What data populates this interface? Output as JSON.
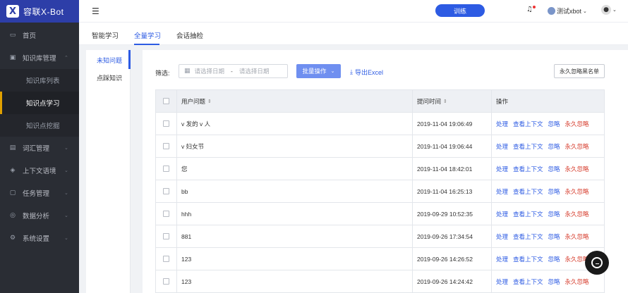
{
  "app": {
    "logo_mark": "X",
    "name": "容联X-Bot"
  },
  "sidebar": {
    "items": [
      {
        "label": "首页",
        "icon": "monitor-icon",
        "glyph": "▭"
      },
      {
        "label": "知识库管理",
        "icon": "book-icon",
        "glyph": "▣",
        "caret": "⌃"
      },
      {
        "label": "词汇管理",
        "icon": "vocabulary-icon",
        "glyph": "▤",
        "caret": "⌄"
      },
      {
        "label": "上下文语境",
        "icon": "graduation-icon",
        "glyph": "◈",
        "caret": "⌄"
      },
      {
        "label": "任务管理",
        "icon": "briefcase-icon",
        "glyph": "▢",
        "caret": "⌄"
      },
      {
        "label": "数据分析",
        "icon": "chart-icon",
        "glyph": "◎",
        "caret": "⌄"
      },
      {
        "label": "系统设置",
        "icon": "gear-icon",
        "glyph": "⚙",
        "caret": "⌄"
      }
    ],
    "subitems": [
      "知识库列表",
      "知识点学习",
      "知识点挖掘"
    ]
  },
  "header": {
    "menu_glyph": "☰",
    "train_label": "训练",
    "bell_glyph": "♫",
    "username": "测试xbot",
    "user_caret": "⌄",
    "avatar_glyph": "●",
    "avatar_caret": "⌄"
  },
  "tabs": [
    "智能学习",
    "全量学习",
    "会话抽检"
  ],
  "subnav": [
    "未知问题",
    "点踩知识"
  ],
  "toolbar": {
    "filter_label": "筛选:",
    "calendar_glyph": "▦",
    "start_placeholder": "请选择日期",
    "range_dash": "-",
    "end_placeholder": "请选择日期",
    "batch_label": "批量操作",
    "batch_caret": "⌄",
    "export_glyph": "⤓",
    "export_label": "导出Excel",
    "blacklist_label": "永久忽略黑名单"
  },
  "table": {
    "headers": {
      "question": "用户问题",
      "time": "提问时间",
      "ops": "操作"
    },
    "sort_glyph": "⇕",
    "actions": [
      "处理",
      "查看上下文",
      "忽略",
      "永久忽略"
    ],
    "rows": [
      {
        "question": "v 发的 v 人",
        "time": "2019-11-04 19:06:49"
      },
      {
        "question": "v 妇女节",
        "time": "2019-11-04 19:06:44"
      },
      {
        "question": "您",
        "time": "2019-11-04 18:42:01"
      },
      {
        "question": "bb",
        "time": "2019-11-04 16:25:13"
      },
      {
        "question": "hhh",
        "time": "2019-09-29 10:52:35"
      },
      {
        "question": "881",
        "time": "2019-09-26 17:34:54"
      },
      {
        "question": "123",
        "time": "2019-09-26 14:26:52"
      },
      {
        "question": "123",
        "time": "2019-09-26 14:24:42"
      }
    ]
  },
  "colors": {
    "primary": "#2d5be3",
    "sidebar_bg": "#2a2d34",
    "danger": "#d63a2a",
    "active_marker": "#e0a000"
  }
}
